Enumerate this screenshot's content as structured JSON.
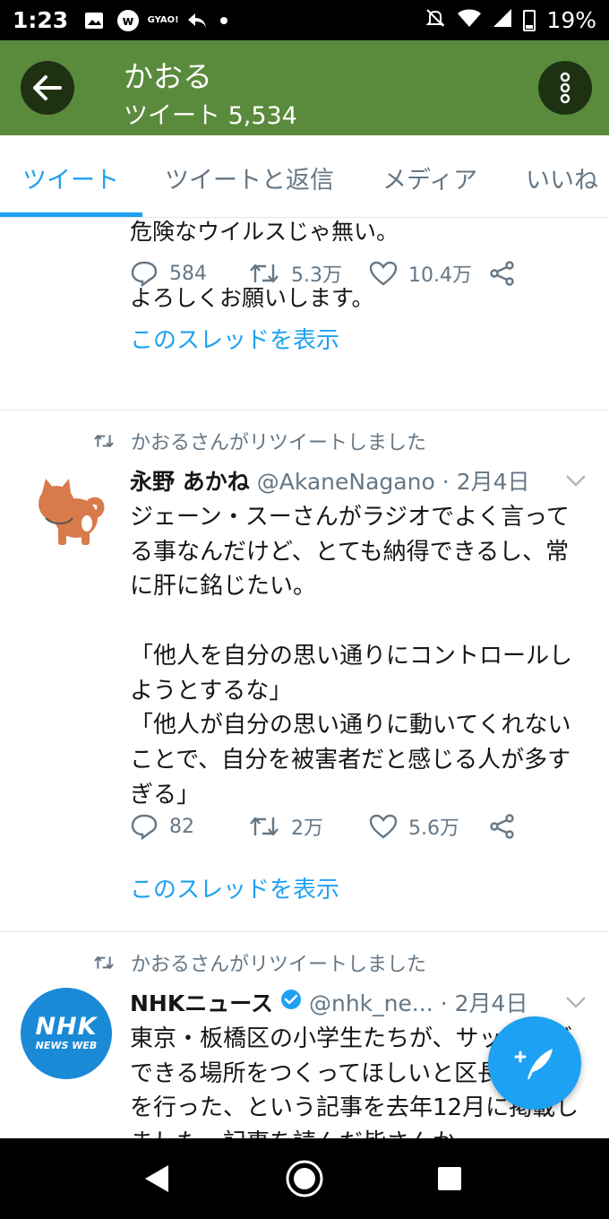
{
  "status_bar": {
    "time": "1:23",
    "notification_icons": [
      "gallery-icon",
      "line-style-app-icon",
      "gyao-app-icon",
      "reply-arrow-icon",
      "dot-icon"
    ],
    "gyao_text": "GYAO!",
    "battery": "19%"
  },
  "header": {
    "title": "かおる",
    "subtitle": "ツイート 5,534",
    "color": "#5a8a3c"
  },
  "tabs": [
    {
      "label": "ツイート",
      "active": true
    },
    {
      "label": "ツイートと返信",
      "active": false
    },
    {
      "label": "メディア",
      "active": false
    },
    {
      "label": "いいね",
      "active": false
    }
  ],
  "accent_color": "#1da1f2",
  "tweets": [
    {
      "partial_line": "危険なウイルスじゃ無い。",
      "text": "よろしくお願いします。",
      "replies": "584",
      "retweets": "5.3万",
      "likes": "10.4万",
      "thread_link": "このスレッドを表示"
    },
    {
      "retweet_label": "かおるさんがリツイートしました",
      "name": "永野 あかね",
      "handle": "@AkaneNagano",
      "separator": "·",
      "date": "2月4日",
      "text": "ジェーン・スーさんがラジオでよく言ってる事なんだけど、とても納得できるし、常に肝に銘じたい。\n\n「他人を自分の思い通りにコントロールしようとするな」\n「他人が自分の思い通りに動いてくれないことで、自分を被害者だと感じる人が多すぎる」",
      "replies": "82",
      "retweets": "2万",
      "likes": "5.6万",
      "thread_link": "このスレッドを表示"
    },
    {
      "retweet_label": "かおるさんがリツイートしました",
      "name": "NHKニュース",
      "verified": true,
      "handle": "@nhk_ne...",
      "separator": "·",
      "date": "2月4日",
      "avatar_text": "NHK",
      "avatar_subtext": "NEWS WEB",
      "text": "東京・板橋区の小学生たちが、サッカーができる場所をつくってほしいと区長に陳情を行った、という記事を去年12月に掲載しました。記事を読んだ皆さんか"
    }
  ]
}
